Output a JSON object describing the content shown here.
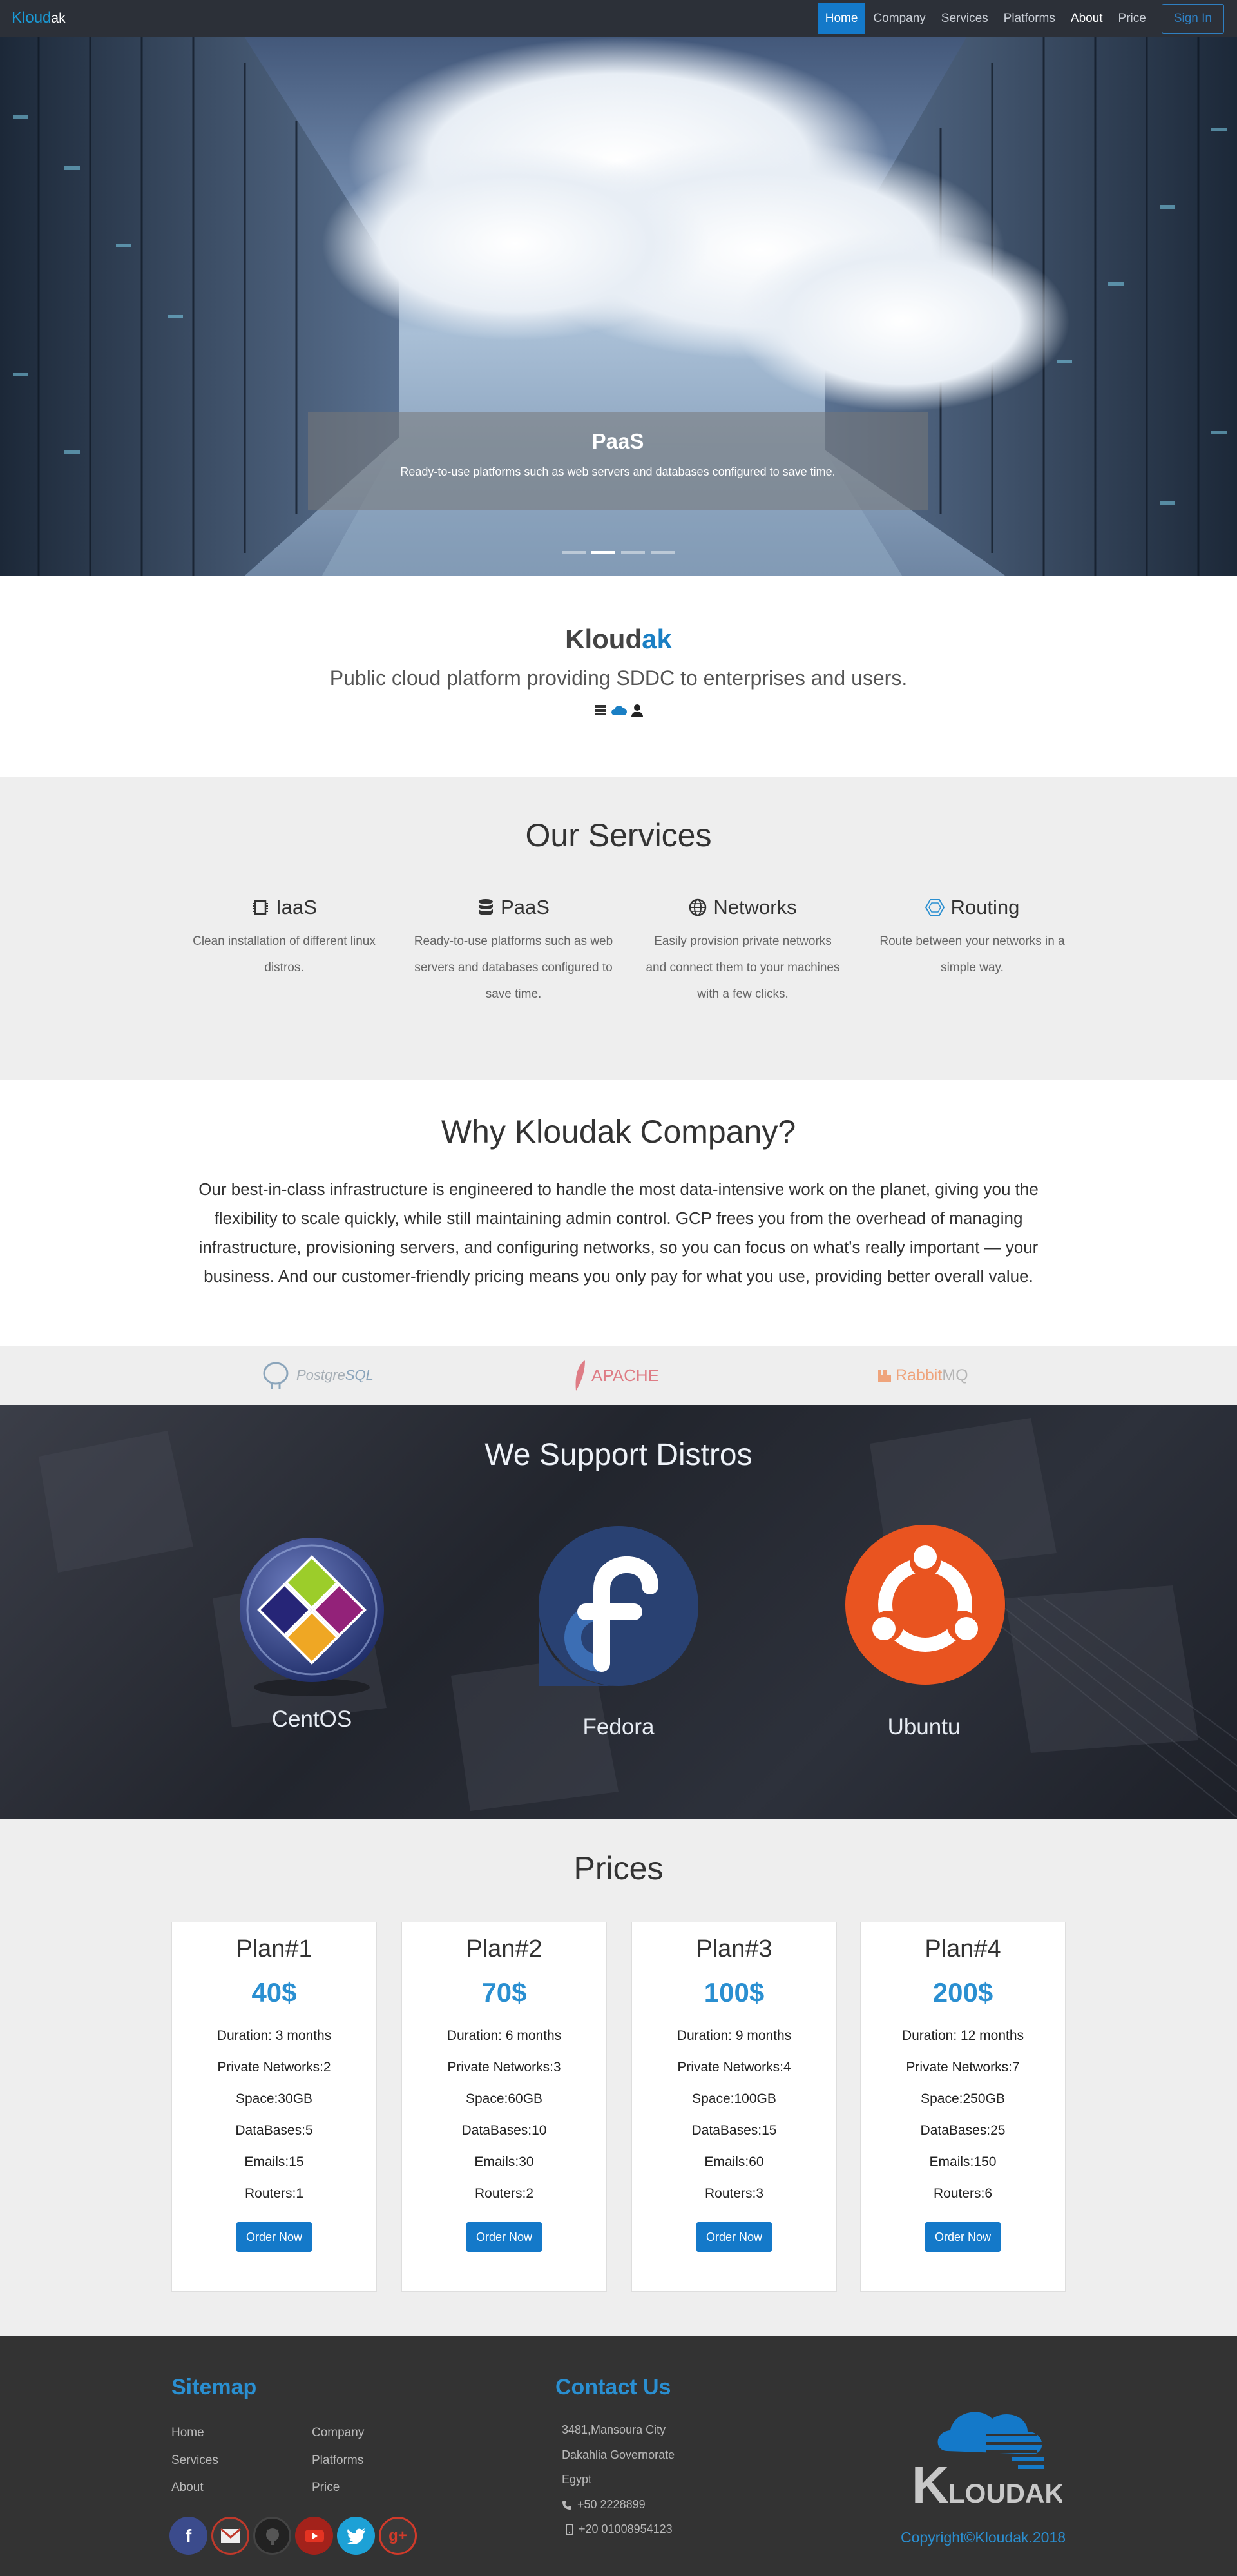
{
  "navbar": {
    "brand_part1": "Kloud",
    "brand_part2": "ak",
    "items": [
      "Home",
      "Company",
      "Services",
      "Platforms",
      "About",
      "Price"
    ],
    "signin_label": "Sign In"
  },
  "hero": {
    "caption_title": "PaaS",
    "caption_text": "Ready-to-use platforms such as web servers and databases configured to save time.",
    "slide_count": 4,
    "active_slide": 2
  },
  "intro": {
    "title_part1": "Kloud",
    "title_part2": "ak",
    "subtitle": "Public cloud platform providing SDDC to enterprises and users.",
    "icons": [
      "server-icon",
      "cloud-icon",
      "user-icon"
    ]
  },
  "services": {
    "title": "Our Services",
    "items": [
      {
        "icon": "chip-icon",
        "name": "IaaS",
        "text": "Clean installation of different linux distros."
      },
      {
        "icon": "database-icon",
        "name": "PaaS",
        "text": "Ready-to-use platforms such as web servers and databases configured to save time."
      },
      {
        "icon": "globe-icon",
        "name": "Networks",
        "text": "Easily provision private networks and connect them to your machines with a few clicks."
      },
      {
        "icon": "routing-icon",
        "name": "Routing",
        "text": "Route between your networks in a simple way."
      }
    ]
  },
  "why": {
    "title": "Why Kloudak Company?",
    "text": "Our best-in-class infrastructure is engineered to handle the most data-intensive work on the planet, giving you the flexibility to scale quickly, while still maintaining admin control. GCP frees you from the overhead of managing infrastructure, provisioning servers, and configuring networks, so you can focus on what's really important — your business. And our customer-friendly pricing means you only pay for what you use, providing better overall value."
  },
  "partners": {
    "postgres_a": "Postgre",
    "postgres_b": "SQL",
    "apache": "APACHE",
    "rabbit_a": "Rabbit",
    "rabbit_b": "MQ"
  },
  "distros": {
    "title": "We Support Distros",
    "items": [
      "CentOS",
      "Fedora",
      "Ubuntu"
    ]
  },
  "prices": {
    "title": "Prices",
    "order_label": "Order Now",
    "plans": [
      {
        "name": "Plan#1",
        "price": "40$",
        "features": [
          "Duration: 3 months",
          "Private Networks:2",
          "Space:30GB",
          "DataBases:5",
          "Emails:15",
          "Routers:1"
        ]
      },
      {
        "name": "Plan#2",
        "price": "70$",
        "features": [
          "Duration: 6 months",
          "Private Networks:3",
          "Space:60GB",
          "DataBases:10",
          "Emails:30",
          "Routers:2"
        ]
      },
      {
        "name": "Plan#3",
        "price": "100$",
        "features": [
          "Duration: 9 months",
          "Private Networks:4",
          "Space:100GB",
          "DataBases:15",
          "Emails:60",
          "Routers:3"
        ]
      },
      {
        "name": "Plan#4",
        "price": "200$",
        "features": [
          "Duration: 12 months",
          "Private Networks:7",
          "Space:250GB",
          "DataBases:25",
          "Emails:150",
          "Routers:6"
        ]
      }
    ]
  },
  "footer": {
    "sitemap_title": "Sitemap",
    "sitemap_links": [
      "Home",
      "Company",
      "Services",
      "Platforms",
      "About",
      "Price"
    ],
    "contact_title": "Contact Us",
    "address": [
      "3481,Mansoura City",
      "Dakahlia Governorate",
      "Egypt"
    ],
    "phone": "+50 2228899",
    "mobile": "+20 01008954123",
    "logo_text": "KLOUDAK",
    "copyright": "Copyright©Kloudak.2018",
    "social": [
      "facebook-icon",
      "gmail-icon",
      "github-icon",
      "youtube-icon",
      "twitter-icon",
      "google-plus-icon"
    ]
  },
  "colors": {
    "accent": "#1479c9",
    "brand_blue": "#2a8fd1",
    "navbar_bg": "#2c3038",
    "section_gray": "#eeeeee",
    "footer_bg": "#333333"
  }
}
